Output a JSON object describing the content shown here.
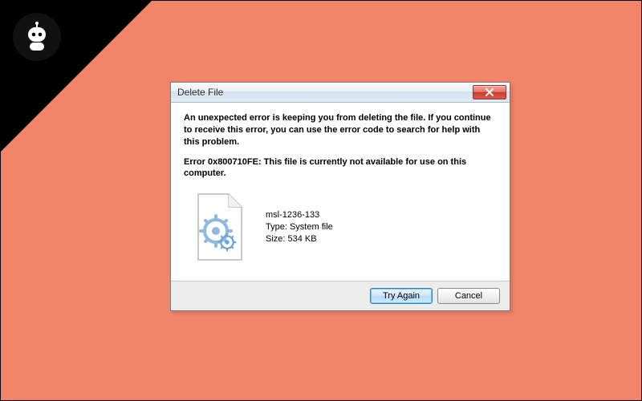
{
  "dialog": {
    "title": "Delete File",
    "message": "An unexpected error is keeping you from deleting the file. If you continue to receive this error, you can use the error code to search for help with this problem.",
    "error_line": "Error 0x800710FE: This file is currently not available for use on this computer.",
    "file": {
      "name": "msl-1236-133",
      "type_label": "Type: System file",
      "size_label": "Size: 534 KB"
    },
    "buttons": {
      "try_again": "Try Again",
      "cancel": "Cancel"
    }
  },
  "icons": {
    "close": "close-icon",
    "robot_logo": "robot-logo-icon",
    "system_file": "system-file-icon"
  }
}
